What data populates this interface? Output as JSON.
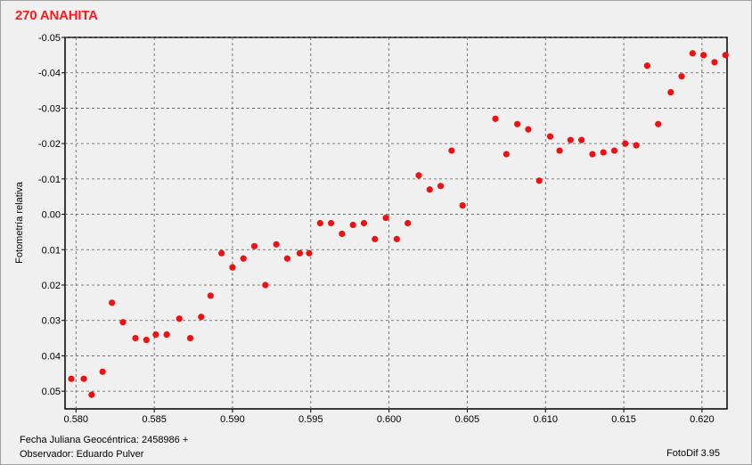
{
  "window": {
    "title": "270 ANAHITA",
    "julian_date_label": "Fecha Juliana Geocéntrica: 2458986 +",
    "observer_label": "Observador: Eduardo Pulver",
    "software_label": "FotoDif 3.95"
  },
  "colors": {
    "title": "#ff1a1a",
    "point": "#ee1111",
    "grid": "#5a5a5a",
    "background": "#f0f0f0"
  },
  "chart_data": {
    "type": "scatter",
    "title": "270 ANAHITA",
    "xlabel": "",
    "ylabel": "Fotometría relativa",
    "xlim": [
      0.5793,
      0.6216
    ],
    "ylim": [
      0.055,
      -0.05
    ],
    "y_inverted": true,
    "grid": true,
    "x_ticks": [
      "0.580",
      "0.585",
      "0.590",
      "0.595",
      "0.600",
      "0.605",
      "0.610",
      "0.615",
      "0.620"
    ],
    "x_tick_values": [
      0.58,
      0.585,
      0.59,
      0.595,
      0.6,
      0.605,
      0.61,
      0.615,
      0.62
    ],
    "y_ticks": [
      "-0.05",
      "-0.04",
      "-0.03",
      "-0.02",
      "-0.01",
      "0.00",
      "0.01",
      "0.02",
      "0.03",
      "0.04",
      "0.05"
    ],
    "y_tick_values": [
      -0.05,
      -0.04,
      -0.03,
      -0.02,
      -0.01,
      0.0,
      0.01,
      0.02,
      0.03,
      0.04,
      0.05
    ],
    "series": [
      {
        "points": [
          [
            0.5797,
            0.0465
          ],
          [
            0.5805,
            0.0465
          ],
          [
            0.581,
            0.051
          ],
          [
            0.5817,
            0.0445
          ],
          [
            0.5823,
            0.025
          ],
          [
            0.583,
            0.0305
          ],
          [
            0.5838,
            0.035
          ],
          [
            0.5845,
            0.0355
          ],
          [
            0.5851,
            0.034
          ],
          [
            0.5858,
            0.034
          ],
          [
            0.5866,
            0.0295
          ],
          [
            0.5873,
            0.035
          ],
          [
            0.588,
            0.029
          ],
          [
            0.5886,
            0.023
          ],
          [
            0.5893,
            0.011
          ],
          [
            0.59,
            0.015
          ],
          [
            0.5907,
            0.0125
          ],
          [
            0.5914,
            0.009
          ],
          [
            0.5921,
            0.02
          ],
          [
            0.5928,
            0.0085
          ],
          [
            0.5935,
            0.0125
          ],
          [
            0.5943,
            0.011
          ],
          [
            0.5949,
            0.011
          ],
          [
            0.5956,
            0.0025
          ],
          [
            0.5963,
            0.0025
          ],
          [
            0.597,
            0.0055
          ],
          [
            0.5977,
            0.003
          ],
          [
            0.5984,
            0.0025
          ],
          [
            0.5991,
            0.007
          ],
          [
            0.5998,
            0.001
          ],
          [
            0.6005,
            0.007
          ],
          [
            0.6012,
            0.0025
          ],
          [
            0.6019,
            -0.011
          ],
          [
            0.6026,
            -0.007
          ],
          [
            0.6033,
            -0.008
          ],
          [
            0.604,
            -0.018
          ],
          [
            0.6047,
            -0.0025
          ],
          [
            0.6068,
            -0.027
          ],
          [
            0.6075,
            -0.017
          ],
          [
            0.6082,
            -0.0255
          ],
          [
            0.6089,
            -0.024
          ],
          [
            0.6096,
            -0.0095
          ],
          [
            0.6103,
            -0.022
          ],
          [
            0.6109,
            -0.018
          ],
          [
            0.6116,
            -0.021
          ],
          [
            0.6123,
            -0.021
          ],
          [
            0.613,
            -0.017
          ],
          [
            0.6137,
            -0.0175
          ],
          [
            0.6144,
            -0.018
          ],
          [
            0.6151,
            -0.02
          ],
          [
            0.6158,
            -0.0195
          ],
          [
            0.6165,
            -0.042
          ],
          [
            0.6172,
            -0.0255
          ],
          [
            0.618,
            -0.0345
          ],
          [
            0.6187,
            -0.039
          ],
          [
            0.6194,
            -0.0455
          ],
          [
            0.6201,
            -0.045
          ],
          [
            0.6208,
            -0.043
          ],
          [
            0.6215,
            -0.045
          ]
        ]
      }
    ]
  }
}
